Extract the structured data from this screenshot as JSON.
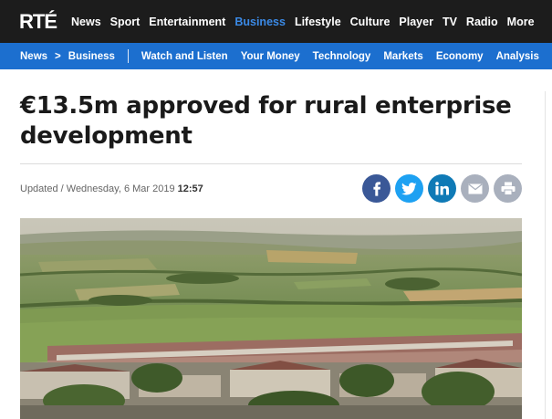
{
  "header": {
    "logo_text": "RTÉ",
    "nav": [
      "News",
      "Sport",
      "Entertainment",
      "Business",
      "Lifestyle",
      "Culture",
      "Player",
      "TV",
      "Radio",
      "More"
    ],
    "active_nav": "Business"
  },
  "subheader": {
    "breadcrumb": [
      "News",
      "Business"
    ],
    "breadcrumb_separator": ">",
    "links": [
      "Watch and Listen",
      "Your Money",
      "Technology",
      "Markets",
      "Economy",
      "Analysis"
    ]
  },
  "article": {
    "headline": "€13.5m approved for rural enterprise development",
    "updated_prefix": "Updated / Wednesday, 6 Mar 2019",
    "updated_time": "12:57"
  },
  "share": {
    "icons": [
      "facebook-icon",
      "twitter-icon",
      "linkedin-icon",
      "email-icon",
      "print-icon"
    ]
  },
  "colors": {
    "topbar": "#1c1c1c",
    "subbar": "#1c6fcf",
    "active_nav": "#3b8ae6",
    "facebook": "#3a5897",
    "twitter": "#1da1f2",
    "linkedin": "#0f7ab6",
    "grey_button": "#a9b0bd"
  }
}
